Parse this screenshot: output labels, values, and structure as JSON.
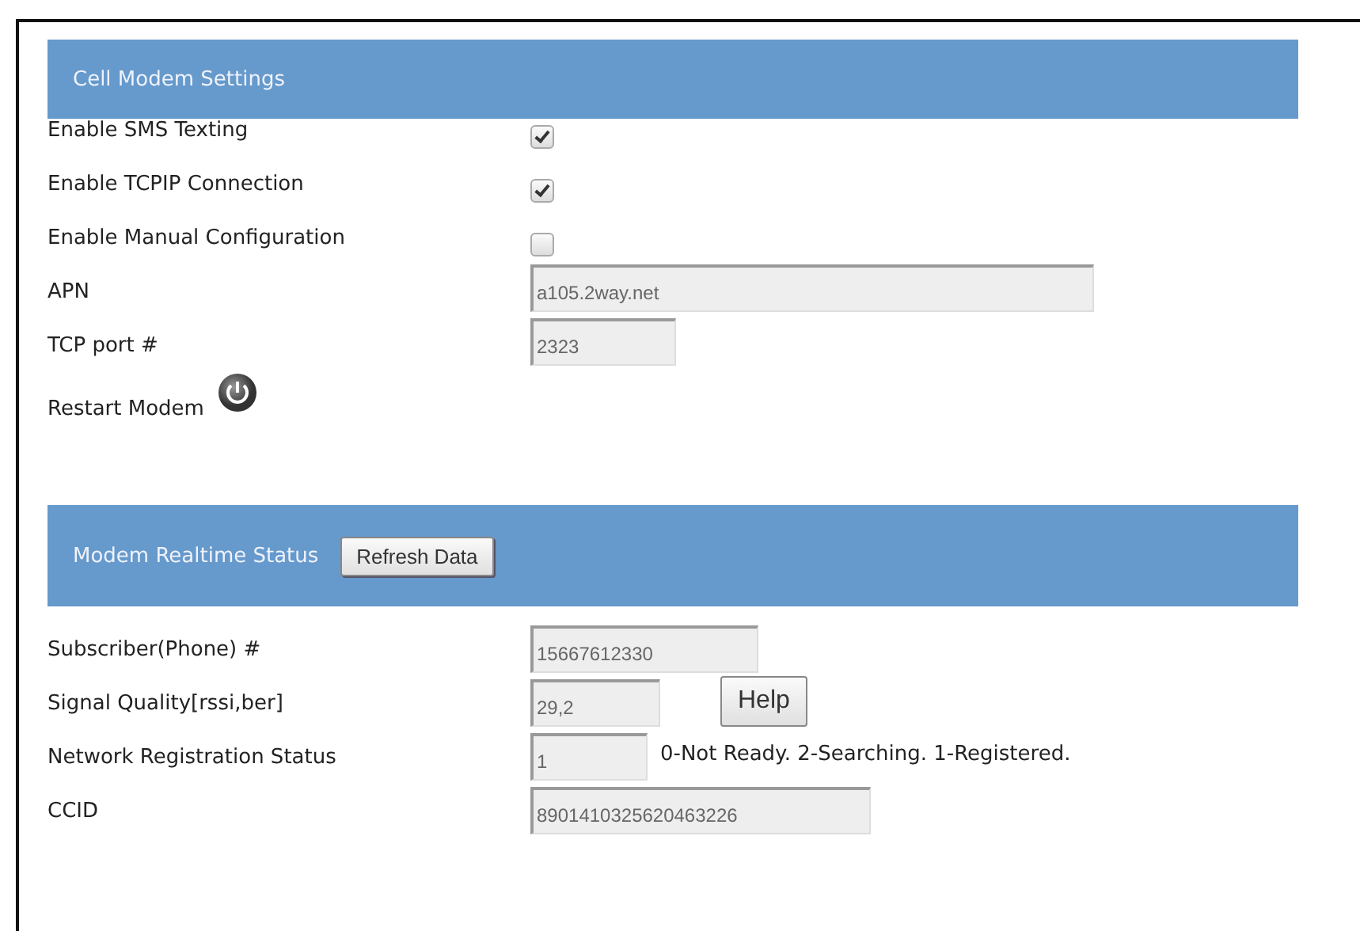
{
  "sections": [
    {
      "title": "Cell Modem Settings",
      "rows": [
        {
          "kind": "checkbox",
          "label": "Enable SMS Texting",
          "checked": true
        },
        {
          "kind": "checkbox",
          "label": "Enable TCPIP Connection",
          "checked": true
        },
        {
          "kind": "checkbox",
          "label": "Enable Manual Configuration",
          "checked": false
        },
        {
          "kind": "field",
          "label": "APN",
          "value": "a105.2way.net"
        },
        {
          "kind": "field",
          "label": "TCP port #",
          "value": "2323"
        },
        {
          "kind": "power",
          "label": "Restart Modem"
        }
      ]
    },
    {
      "title": "Modem Realtime Status",
      "button": "Refresh Data",
      "rows": [
        {
          "kind": "field",
          "label": "Subscriber(Phone) #",
          "value": "15667612330"
        },
        {
          "kind": "field_button",
          "label": "Signal Quality[rssi,ber]",
          "value": "29,2",
          "button": "Help"
        },
        {
          "kind": "field_note",
          "label": "Network Registration Status",
          "value": "1",
          "note": "0-Not Ready. 2-Searching. 1-Registered."
        },
        {
          "kind": "field",
          "label": "CCID",
          "value": "8901410325620463226"
        }
      ]
    }
  ]
}
